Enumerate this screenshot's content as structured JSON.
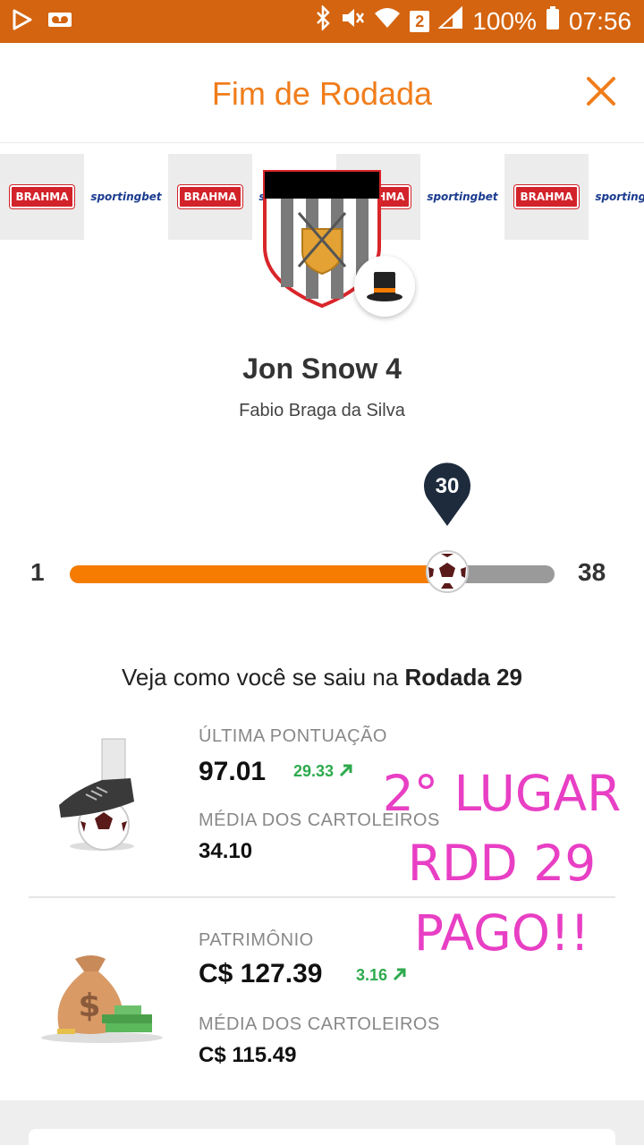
{
  "status_bar": {
    "battery": "100%",
    "time": "07:56",
    "sim_badge": "2"
  },
  "header": {
    "title": "Fim de Rodada"
  },
  "sponsors": {
    "brahma": "BRAHMA",
    "sportingbet": "sportingbet"
  },
  "team": {
    "name": "Jon Snow 4",
    "owner": "Fabio Braga da Silva"
  },
  "progress": {
    "start": "1",
    "end": "38",
    "current": "30",
    "fraction": 0.78
  },
  "round": {
    "prefix": "Veja como você se saiu na ",
    "label": "Rodada 29"
  },
  "score": {
    "label": "ÚLTIMA PONTUAÇÃO",
    "value": "97.01",
    "delta": "29.33",
    "avg_label": "MÉDIA DOS CARTOLEIROS",
    "avg_value": "34.10"
  },
  "patrimonio": {
    "label": "PATRIMÔNIO",
    "value": "C$ 127.39",
    "delta": "3.16",
    "avg_label": "MÉDIA DOS CARTOLEIROS",
    "avg_value": "C$ 115.49"
  },
  "overlay": {
    "line1": "2° LUGAR",
    "line2": "RDD 29",
    "line3": "PAGO!!"
  },
  "colors": {
    "status_bar": "#d4640f",
    "accent": "#f07d1b",
    "progress_fill": "#f57c00",
    "positive": "#2eaa4d",
    "overlay_text": "#e83fc4"
  }
}
